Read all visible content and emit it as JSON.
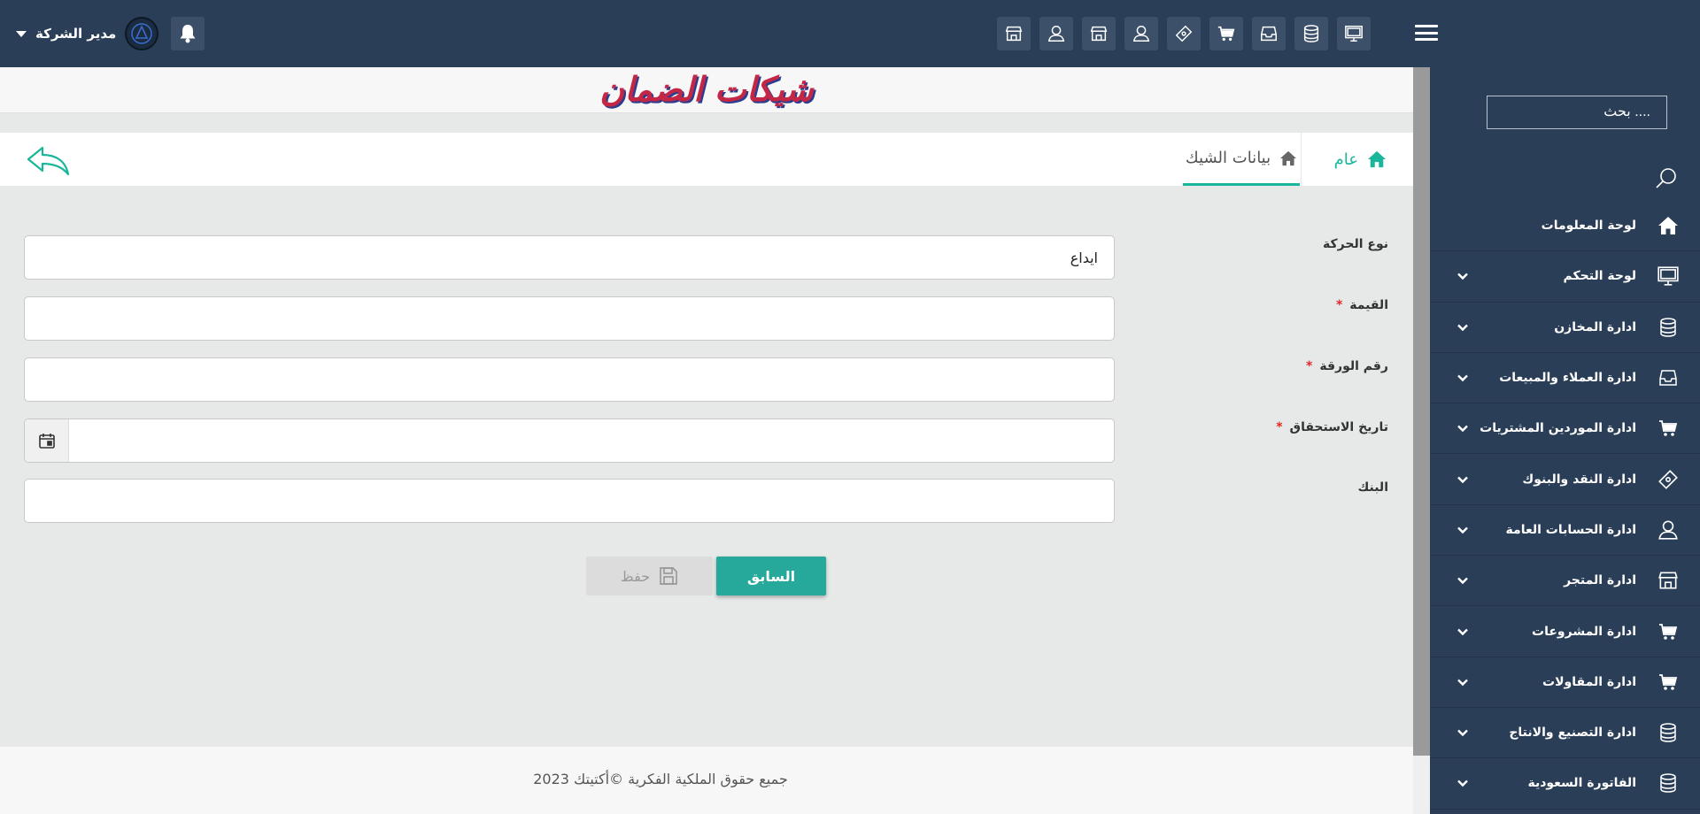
{
  "header": {
    "user_name": "مدير الشركة",
    "icons": [
      "store-icon",
      "user-icon",
      "store-icon",
      "user-icon",
      "ticket-icon",
      "cart-icon",
      "inbox-icon",
      "database-icon",
      "monitor-icon"
    ]
  },
  "sidebar": {
    "search_placeholder": "بحث ....",
    "items": [
      {
        "label": "لوحة المعلومات",
        "icon": "home-icon",
        "expandable": false
      },
      {
        "label": "لوحة التحكم",
        "icon": "monitor-icon",
        "expandable": true
      },
      {
        "label": "ادارة المخازن",
        "icon": "database-icon",
        "expandable": true
      },
      {
        "label": "ادارة العملاء والمبيعات",
        "icon": "inbox-icon",
        "expandable": true
      },
      {
        "label": "ادارة الموردين المشتريات",
        "icon": "cart-icon",
        "expandable": true
      },
      {
        "label": "ادارة النقد والبنوك",
        "icon": "ticket-icon",
        "expandable": true
      },
      {
        "label": "ادارة الحسابات العامة",
        "icon": "user-icon",
        "expandable": true
      },
      {
        "label": "ادارة المتجر",
        "icon": "store-icon",
        "expandable": true
      },
      {
        "label": "ادارة المشروعات",
        "icon": "cart-icon",
        "expandable": true
      },
      {
        "label": "ادارة المقاولات",
        "icon": "cart-icon",
        "expandable": true
      },
      {
        "label": "ادارة التصنيع والانتاج",
        "icon": "database-icon",
        "expandable": true
      },
      {
        "label": "الفاتورة السعودية",
        "icon": "database-icon",
        "expandable": true
      }
    ]
  },
  "page": {
    "title": "شيكات الضمان",
    "tabs": {
      "general": "عام",
      "cheque_data": "بيانات الشيك"
    }
  },
  "form": {
    "movement_type": {
      "label": "نوع الحركة",
      "value": "ايداع",
      "required": false
    },
    "amount": {
      "label": "القيمة",
      "value": "",
      "required": true
    },
    "paper_number": {
      "label": "رقم الورقة",
      "value": "",
      "required": true
    },
    "due_date": {
      "label": "تاريخ الاستحقاق",
      "value": "",
      "required": true
    },
    "bank": {
      "label": "البنك",
      "value": "",
      "required": false
    },
    "required_mark": "*"
  },
  "buttons": {
    "previous": "السابق",
    "save": "حفظ"
  },
  "footer": {
    "text": "جميع حقوق الملكية الفكرية ©أكتيتك 2023"
  },
  "colors": {
    "header_bg": "#2a3e57",
    "accent": "#1ab69b",
    "primary_button": "#26a99a",
    "title_red": "#c42646",
    "required_red": "#e02828"
  }
}
